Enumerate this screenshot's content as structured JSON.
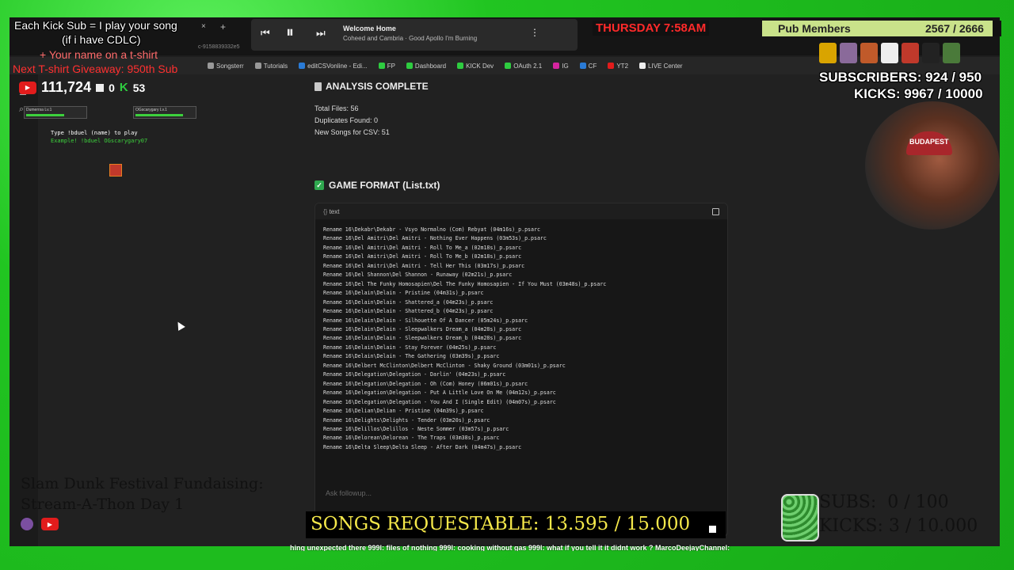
{
  "overlay": {
    "kick_sub_line1": "Each Kick Sub = I play your song",
    "kick_sub_line2": "(if i have CDLC)",
    "tshirt_line": "+ Your name on a t-shirt",
    "giveaway_line": "Next T-shirt Giveaway: 950th Sub",
    "yt_count": "111,724",
    "twitch_count": "0",
    "kick_count": "53",
    "day_time": "THURSDAY 7:58AM",
    "pub_members_label": "Pub Members",
    "pub_members_count": "2567 / 2666",
    "subscribers_line": "SUBSCRIBERS: 924 / 950",
    "kicks_line": "KICKS: 9967 / 10000",
    "fundraising_line1": "Slam Dunk Festival Fundaising:",
    "fundraising_line2": "Stream-A-Thon Day 1",
    "songs_requestable": "SONGS REQUESTABLE: 13.595 / 15.000",
    "subs_goal": "SUBS:  0 / 100",
    "kicks_goal": "KICKS: 3 / 10.000",
    "ticker": "hing unexpected there  999l: files of nothing  999l: cooking without gas  999l: what if you tell it it didnt work ?  MarcoDeejayChannel:",
    "hat_text": "BUDAPEST"
  },
  "media": {
    "title": "Welcome Home",
    "subtitle": "Coheed and Cambria · Good Apollo I'm Burning"
  },
  "url_fragment": "c-9158839332e5",
  "bookmarks": [
    "Songsterr",
    "Tutorials",
    "editCSVonline - Edi...",
    "FP",
    "Dashboard",
    "KICK Dev",
    "OAuth 2.1",
    "IG",
    "CF",
    "YT2",
    "LIVE Center"
  ],
  "game": {
    "badge1": "Dumerrsa  Lv.1",
    "badge2": "OGscarygary Lv.1",
    "duel_hint": "Type !bduel (name) to play",
    "duel_example": "Example! !bduel OGscarygary07"
  },
  "analysis": {
    "heading": "ANALYSIS COMPLETE",
    "total_files": "Total Files: 56",
    "duplicates": "Duplicates Found: 0",
    "new_songs": "New Songs for CSV: 51",
    "format_heading": "GAME FORMAT (List.txt)",
    "code_lang": "text",
    "ask_placeholder": "Ask followup...",
    "lines": [
      "Rename 16\\Dekabr\\Dekabr - Vsyo Normalno (Com) Rebyat (04m16s)_p.psarc",
      "Rename 16\\Del Amitri\\Del Amitri - Nothing Ever Happens (03m53s)_p.psarc",
      "Rename 16\\Del Amitri\\Del Amitri - Roll To Me_a (02m18s)_p.psarc",
      "Rename 16\\Del Amitri\\Del Amitri - Roll To Me_b (02m18s)_p.psarc",
      "Rename 16\\Del Amitri\\Del Amitri - Tell Her This (03m17s)_p.psarc",
      "Rename 16\\Del Shannon\\Del Shannon - Runaway (02m21s)_p.psarc",
      "Rename 16\\Del The Funky Homosapien\\Del The Funky Homosapien - If You Must (03m48s)_p.psarc",
      "Rename 16\\Delain\\Delain - Pristine (04m31s)_p.psarc",
      "Rename 16\\Delain\\Delain - Shattered_a (04m23s)_p.psarc",
      "Rename 16\\Delain\\Delain - Shattered_b (04m23s)_p.psarc",
      "Rename 16\\Delain\\Delain - Silhouette Of A Dancer (05m24s)_p.psarc",
      "Rename 16\\Delain\\Delain - Sleepwalkers Dream_a (04m28s)_p.psarc",
      "Rename 16\\Delain\\Delain - Sleepwalkers Dream_b (04m28s)_p.psarc",
      "Rename 16\\Delain\\Delain - Stay Forever (04m25s)_p.psarc",
      "Rename 16\\Delain\\Delain - The Gathering (03m39s)_p.psarc",
      "Rename 16\\Delbert McClinton\\Delbert McClinton - Shaky Ground (03m01s)_p.psarc",
      "Rename 16\\Delegation\\Delegation - Darlin' (04m23s)_p.psarc",
      "Rename 16\\Delegation\\Delegation - Oh (Com) Honey (06m01s)_p.psarc",
      "Rename 16\\Delegation\\Delegation - Put A Little Love On Me (04m12s)_p.psarc",
      "Rename 16\\Delegation\\Delegation - You And I (Single Edit) (04m07s)_p.psarc",
      "Rename 16\\Delian\\Delian - Pristine (04m39s)_p.psarc",
      "Rename 16\\Delights\\Delights - Tender (03m20s)_p.psarc",
      "Rename 16\\Delillos\\Delillos - Neste Sommer (03m57s)_p.psarc",
      "Rename 16\\Delorean\\Delorean - The Traps (03m38s)_p.psarc",
      "Rename 16\\Delta Sleep\\Delta Sleep - After Dark (04m47s)_p.psarc"
    ]
  }
}
